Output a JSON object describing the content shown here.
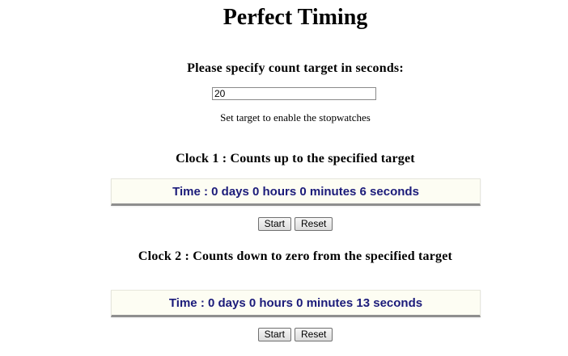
{
  "page": {
    "title": "Perfect Timing",
    "prompt": "Please specify count target in seconds:",
    "hint": "Set target to enable the stopwatches"
  },
  "target_input": {
    "value": "20"
  },
  "clock1": {
    "heading": "Clock 1 : Counts up to the specified target",
    "time_text": "Time : 0 days 0 hours 0 minutes 6 seconds",
    "start_label": "Start",
    "reset_label": "Reset"
  },
  "clock2": {
    "heading": "Clock 2 : Counts down to zero from the specified target",
    "time_text": "Time : 0 days 0 hours 0 minutes 13 seconds",
    "start_label": "Start",
    "reset_label": "Reset"
  },
  "colors": {
    "time_text": "#1b1b7a",
    "time_box_bg": "#fdfdf3"
  }
}
